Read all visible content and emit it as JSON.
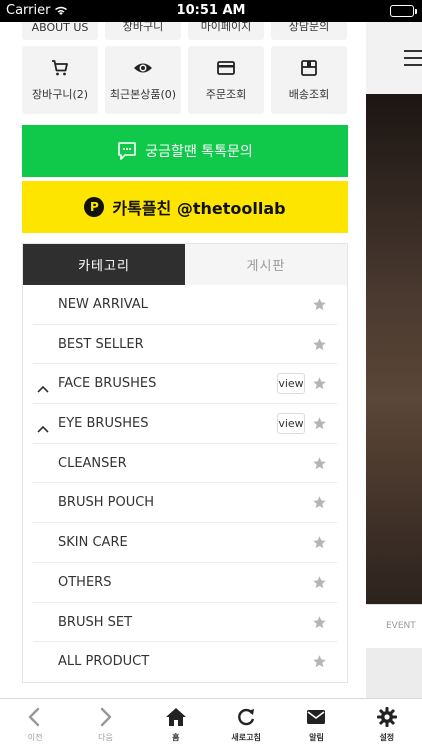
{
  "status_bar": {
    "carrier": "Carrier",
    "time": "10:51 AM",
    "battery_level": 1.0
  },
  "drawer": {
    "top_row_partial": [
      "ABOUT US",
      "장바구니",
      "마이페이지",
      "상담문의"
    ],
    "icon_row": [
      {
        "icon": "cart-icon",
        "label": "장바구니(2)"
      },
      {
        "icon": "eye-icon",
        "label": "최근본상품(0)"
      },
      {
        "icon": "card-icon",
        "label": "주문조회"
      },
      {
        "icon": "box-icon",
        "label": "배송조회"
      }
    ],
    "talk_button": {
      "label": "궁금할땐 톡톡문의",
      "color": "#10c84a"
    },
    "kakao_button": {
      "label": "카톡플친 @thetoollab",
      "color": "#fee500"
    },
    "tabs": [
      {
        "label": "카테고리",
        "active": true
      },
      {
        "label": "게시판",
        "active": false
      }
    ],
    "categories": [
      {
        "name": "NEW ARRIVAL",
        "expandable": false
      },
      {
        "name": "BEST SELLER",
        "expandable": false
      },
      {
        "name": "FACE BRUSHES",
        "expandable": true,
        "view_label": "view"
      },
      {
        "name": "EYE BRUSHES",
        "expandable": true,
        "view_label": "view"
      },
      {
        "name": "CLEANSER",
        "expandable": false
      },
      {
        "name": "BRUSH POUCH",
        "expandable": false
      },
      {
        "name": "SKIN CARE",
        "expandable": false
      },
      {
        "name": "OTHERS",
        "expandable": false
      },
      {
        "name": "BRUSH SET",
        "expandable": false
      },
      {
        "name": "ALL PRODUCT",
        "expandable": false
      }
    ]
  },
  "behind_page": {
    "tab_fragment": "EVENT"
  },
  "toolbar": [
    {
      "icon": "back-icon",
      "label": "이전",
      "enabled": false
    },
    {
      "icon": "forward-icon",
      "label": "다음",
      "enabled": false
    },
    {
      "icon": "home-icon",
      "label": "홈",
      "enabled": true
    },
    {
      "icon": "refresh-icon",
      "label": "새로고침",
      "enabled": true
    },
    {
      "icon": "mail-icon",
      "label": "알림",
      "enabled": true
    },
    {
      "icon": "gear-icon",
      "label": "설정",
      "enabled": true
    }
  ]
}
